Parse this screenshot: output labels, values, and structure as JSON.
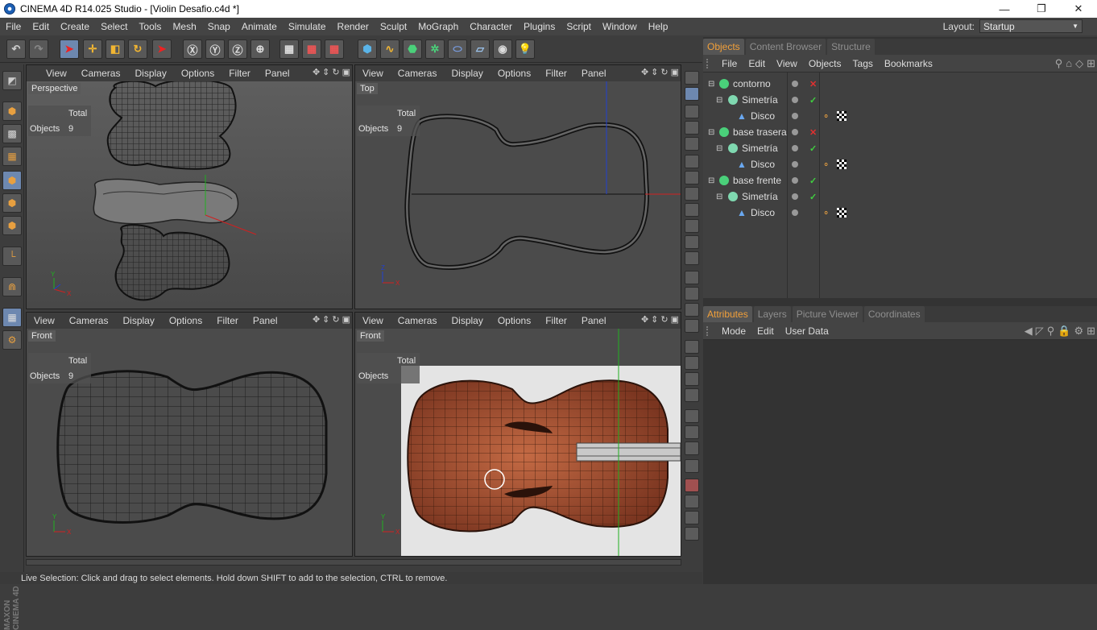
{
  "window": {
    "title": "CINEMA 4D R14.025 Studio - [Violin Desafio.c4d *]",
    "minimize": "—",
    "maximize": "❐",
    "close": "✕"
  },
  "menu": [
    "File",
    "Edit",
    "Create",
    "Select",
    "Tools",
    "Mesh",
    "Snap",
    "Animate",
    "Simulate",
    "Render",
    "Sculpt",
    "MoGraph",
    "Character",
    "Plugins",
    "Script",
    "Window",
    "Help"
  ],
  "layout": {
    "label": "Layout:",
    "value": "Startup"
  },
  "viewport_menu": [
    "View",
    "Cameras",
    "Display",
    "Options",
    "Filter",
    "Panel"
  ],
  "viewports": [
    {
      "name": "Perspective",
      "stats_header": "Total",
      "stats_label": "Objects",
      "stats_value": "9"
    },
    {
      "name": "Top",
      "stats_header": "Total",
      "stats_label": "Objects",
      "stats_value": "9"
    },
    {
      "name": "Front",
      "stats_header": "Total",
      "stats_label": "Objects",
      "stats_value": "9"
    },
    {
      "name": "Front",
      "stats_header": "Total",
      "stats_label": "Objects",
      "stats_value": ""
    }
  ],
  "axis": {
    "x": "X",
    "y": "Y",
    "z": "Z"
  },
  "objects_panel": {
    "tabs": [
      "Objects",
      "Content Browser",
      "Structure"
    ],
    "menu": [
      "File",
      "Edit",
      "View",
      "Objects",
      "Tags",
      "Bookmarks"
    ],
    "rows": [
      {
        "label": "contorno",
        "flag": "✕"
      },
      {
        "label": "Simetría",
        "flag": "✓"
      },
      {
        "label": "Disco",
        "flag": ""
      },
      {
        "label": "base trasera",
        "flag": "✕"
      },
      {
        "label": "Simetría",
        "flag": "✓"
      },
      {
        "label": "Disco",
        "flag": ""
      },
      {
        "label": "base frente",
        "flag": "✓"
      },
      {
        "label": "Simetría",
        "flag": "✓"
      },
      {
        "label": "Disco",
        "flag": ""
      }
    ]
  },
  "attributes_panel": {
    "tabs": [
      "Attributes",
      "Layers",
      "Picture Viewer",
      "Coordinates"
    ],
    "menu": [
      "Mode",
      "Edit",
      "User Data"
    ]
  },
  "maxon_logo": "MAXON CINEMA 4D",
  "status": "Live Selection: Click and drag to select elements. Hold down SHIFT to add to the selection, CTRL to remove.",
  "colors": {
    "accent": "#f2a03a",
    "x_axis": "#d02020",
    "y_axis": "#20b020",
    "z_axis": "#2040d0"
  }
}
